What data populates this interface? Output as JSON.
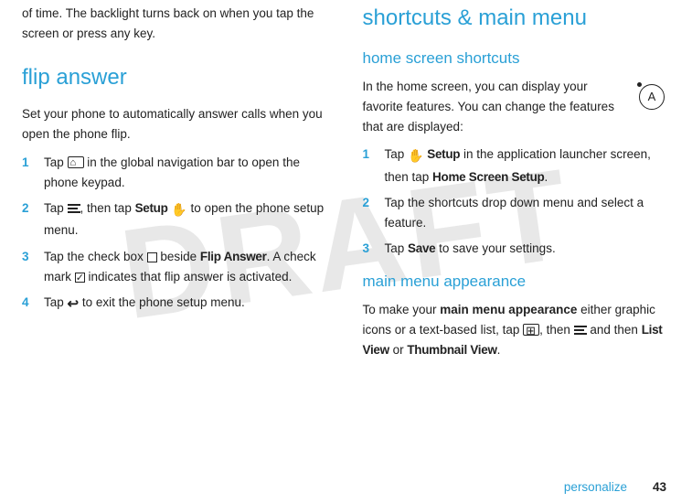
{
  "watermark": "DRAFT",
  "left": {
    "intro": "of time. The backlight turns back on when you tap the screen or press any key.",
    "heading": "flip answer",
    "para": "Set your phone to automatically answer calls when you open the phone flip.",
    "steps": {
      "s1n": "1",
      "s1a": "Tap ",
      "s1b": " in the global navigation bar to open the phone keypad.",
      "s2n": "2",
      "s2a": "Tap ",
      "s2b": ", then tap ",
      "s2_setup": "Setup",
      "s2c": " to open the phone setup menu.",
      "s3n": "3",
      "s3a": "Tap the check box ",
      "s3b": " beside ",
      "s3_flip": "Flip Answer",
      "s3c": ". A check mark ",
      "s3d": " indicates that flip answer is activated.",
      "s4n": "4",
      "s4a": "Tap ",
      "s4b": " to exit the phone setup menu."
    }
  },
  "right": {
    "heading": "shortcuts & main menu",
    "sub1": "home screen shortcuts",
    "para1": "In the home screen, you can display your favorite features. You can change the features that are displayed:",
    "steps": {
      "s1n": "1",
      "s1a": "Tap ",
      "s1_setup": "Setup",
      "s1b": " in the application launcher screen, then tap ",
      "s1_hss": "Home Screen Setup",
      "s1c": ".",
      "s2n": "2",
      "s2": "Tap the shortcuts drop down menu and select a feature.",
      "s3n": "3",
      "s3a": "Tap ",
      "s3_save": "Save",
      "s3b": " to save your settings."
    },
    "sub2": "main menu appearance",
    "para2a": "To make your ",
    "para2_bold": "main menu appearance",
    "para2b": " either graphic icons or a text-based list, tap ",
    "para2c": ", then ",
    "para2d": " and then ",
    "para2_lv": "List View",
    "para2_or": " or ",
    "para2_tv": "Thumbnail View",
    "para2e": "."
  },
  "footer": {
    "section": "personalize",
    "page": "43"
  },
  "corner_glyph": "A"
}
